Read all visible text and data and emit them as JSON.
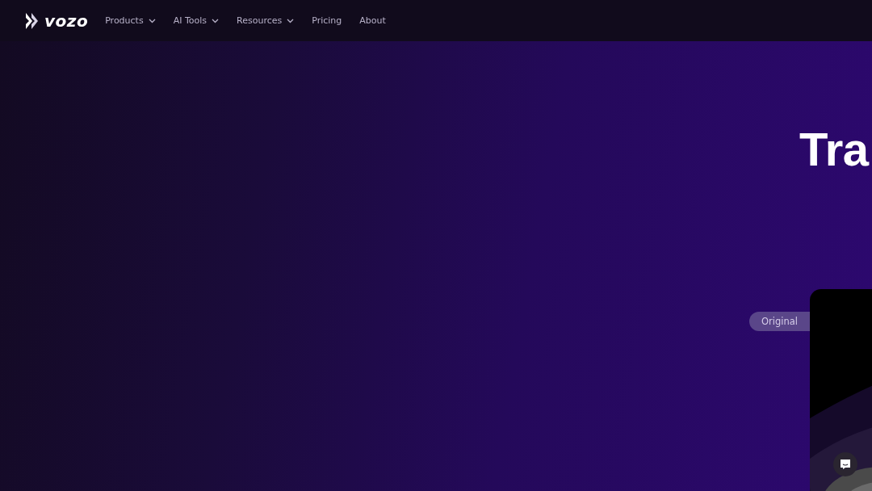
{
  "header": {
    "logo": "vozo",
    "nav": [
      {
        "label": "Products",
        "dropdown": true
      },
      {
        "label": "AI Tools",
        "dropdown": true
      },
      {
        "label": "Resources",
        "dropdown": true
      },
      {
        "label": "Pricing",
        "dropdown": false
      },
      {
        "label": "About",
        "dropdown": false
      }
    ]
  },
  "hero": {
    "heading": "Tra",
    "badge": "Original"
  },
  "chat_button": {
    "kind": "chat"
  }
}
